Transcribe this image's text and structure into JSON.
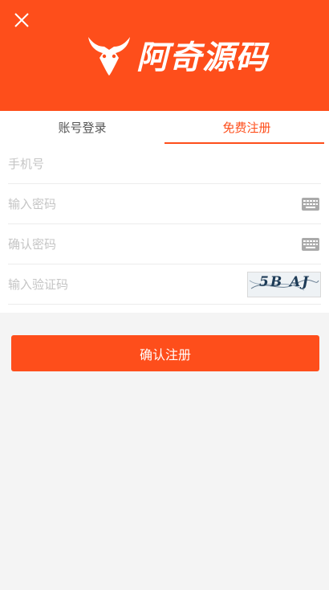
{
  "brand": {
    "logo_text": "阿奇源码",
    "color": "#fe4e1b"
  },
  "header": {
    "close_icon": "close-icon"
  },
  "tabs": [
    {
      "label": "账号登录",
      "active": false
    },
    {
      "label": "免费注册",
      "active": true
    }
  ],
  "form": {
    "phone_placeholder": "手机号",
    "password_placeholder": "输入密码",
    "confirm_placeholder": "确认密码",
    "captcha_placeholder": "输入验证码",
    "keyboard_icon": "keyboard-icon",
    "captcha_text": "5B AJ"
  },
  "submit_label": "确认注册"
}
